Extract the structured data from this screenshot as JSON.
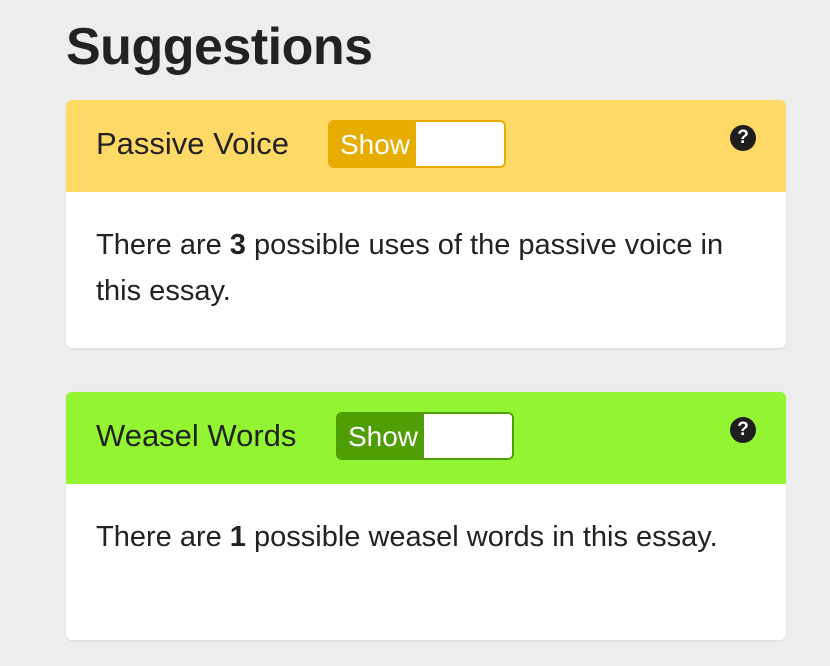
{
  "page": {
    "title": "Suggestions"
  },
  "cards": [
    {
      "id": "passive-voice",
      "title": "Passive Voice",
      "toggle_label": "Show",
      "toggle_state": "on",
      "help_symbol": "?",
      "header_color": "#ffd966",
      "toggle_color": "#e6ad00",
      "body_prefix": "There are ",
      "count": "3",
      "body_suffix": " possible uses of the passive voice in this essay."
    },
    {
      "id": "weasel-words",
      "title": "Weasel Words",
      "toggle_label": "Show",
      "toggle_state": "on",
      "help_symbol": "?",
      "header_color": "#93f531",
      "toggle_color": "#4f9e06",
      "body_prefix": "There are ",
      "count": "1",
      "body_suffix": " possible weasel words in this essay."
    }
  ]
}
